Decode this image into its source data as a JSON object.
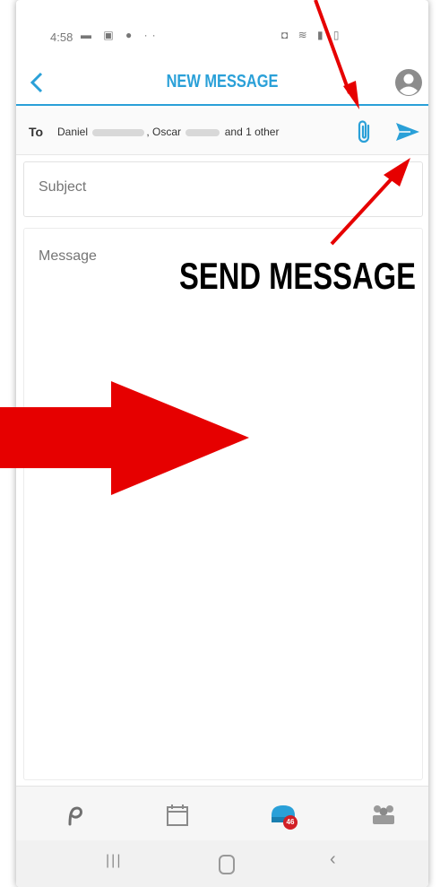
{
  "status_bar": {
    "time": "4:58",
    "left_icons": "▬ ▣ ● ··",
    "right_icons": "◘ ≋ ▮ ▯"
  },
  "app_bar": {
    "title": "NEW MESSAGE",
    "back_icon": "chevron-left-icon",
    "profile_icon": "profile-icon"
  },
  "compose": {
    "to_label": "To",
    "recipients": {
      "first": "Daniel",
      "second": "Oscar",
      "tail": "and 1 other"
    },
    "subject_placeholder": "Subject",
    "message_placeholder": "Message"
  },
  "bottom_nav": {
    "message_badge": "46"
  },
  "annotation": {
    "callout": "SEND MESSAGE"
  },
  "colors": {
    "accent": "#2aa0d8",
    "annotation_red": "#e60000",
    "badge_red": "#d21f26"
  }
}
